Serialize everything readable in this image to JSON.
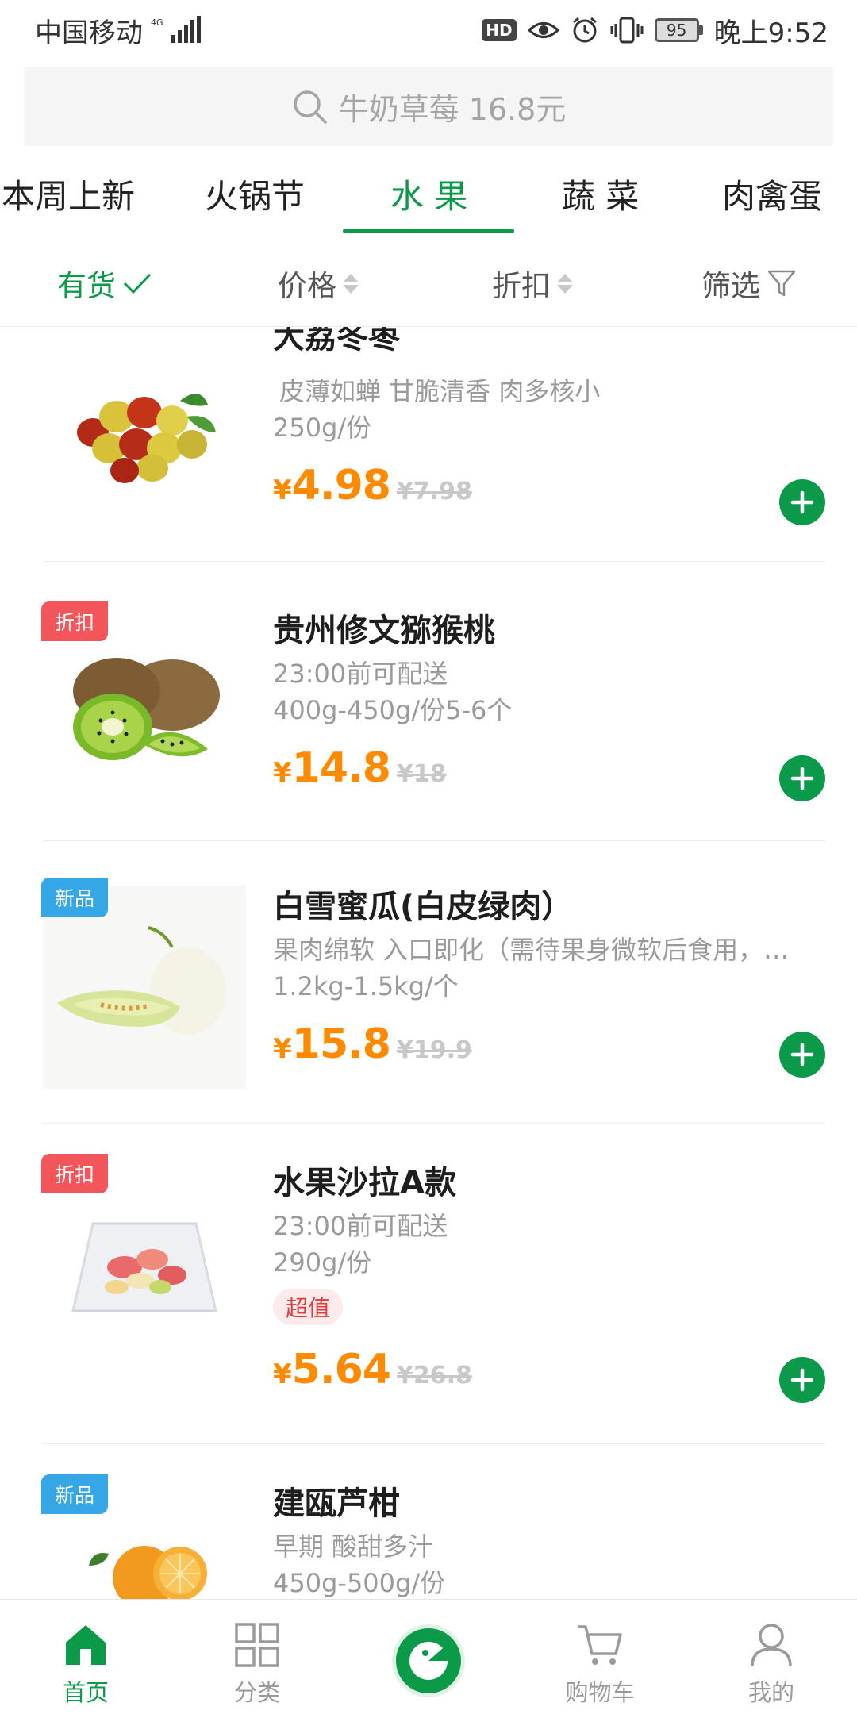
{
  "status_bar": {
    "carrier": "中国移动",
    "network": "4G",
    "hd": "HD",
    "battery": "95",
    "time": "晚上9:52"
  },
  "search": {
    "placeholder": "牛奶草莓 16.8元"
  },
  "category_tabs": [
    {
      "label": "本周上新",
      "active": false
    },
    {
      "label": "火锅节",
      "active": false
    },
    {
      "label": "水 果",
      "active": true
    },
    {
      "label": "蔬 菜",
      "active": false
    },
    {
      "label": "肉禽蛋",
      "active": false
    }
  ],
  "filters": {
    "in_stock": "有货",
    "price": "价格",
    "discount": "折扣",
    "filter": "筛选"
  },
  "products": [
    {
      "name": "大荔冬枣",
      "tag": "",
      "desc": "皮薄如蝉 甘脆清香 肉多核小",
      "spec": "250g/份",
      "badge": "",
      "currency": "¥",
      "price": "4.98",
      "original_price": "¥7.98",
      "image_icon": "jujube-icon"
    },
    {
      "name": "贵州修文猕猴桃",
      "tag": "折扣",
      "desc": "23:00前可配送",
      "spec": "400g-450g/份5-6个",
      "badge": "",
      "currency": "¥",
      "price": "14.8",
      "original_price": "¥18",
      "image_icon": "kiwi-icon"
    },
    {
      "name": "白雪蜜瓜(白皮绿肉）",
      "tag": "新品",
      "desc": "果肉绵软 入口即化（需待果身微软后食用，…",
      "spec": "1.2kg-1.5kg/个",
      "badge": "",
      "currency": "¥",
      "price": "15.8",
      "original_price": "¥19.9",
      "image_icon": "melon-icon"
    },
    {
      "name": "水果沙拉A款",
      "tag": "折扣",
      "desc": "23:00前可配送",
      "spec": "290g/份",
      "badge": "超值",
      "currency": "¥",
      "price": "5.64",
      "original_price": "¥26.8",
      "image_icon": "fruit-salad-icon"
    },
    {
      "name": "建瓯芦柑",
      "tag": "新品",
      "desc": "早期 酸甜多汁",
      "spec": "450g-500g/份",
      "badge": "",
      "currency": "¥",
      "price": "",
      "original_price": "",
      "image_icon": "orange-icon"
    }
  ],
  "bottom_nav": [
    {
      "label": "首页",
      "icon": "home-icon",
      "active": true
    },
    {
      "label": "分类",
      "icon": "grid-icon",
      "active": false
    },
    {
      "label": "",
      "icon": "app-logo-icon",
      "active": false
    },
    {
      "label": "购物车",
      "icon": "cart-icon",
      "active": false
    },
    {
      "label": "我的",
      "icon": "profile-icon",
      "active": false
    }
  ],
  "colors": {
    "brand_green": "#0a9a48",
    "price_orange": "#ff8a00",
    "discount_tag": "#f2555a",
    "new_tag": "#35a7e7"
  }
}
